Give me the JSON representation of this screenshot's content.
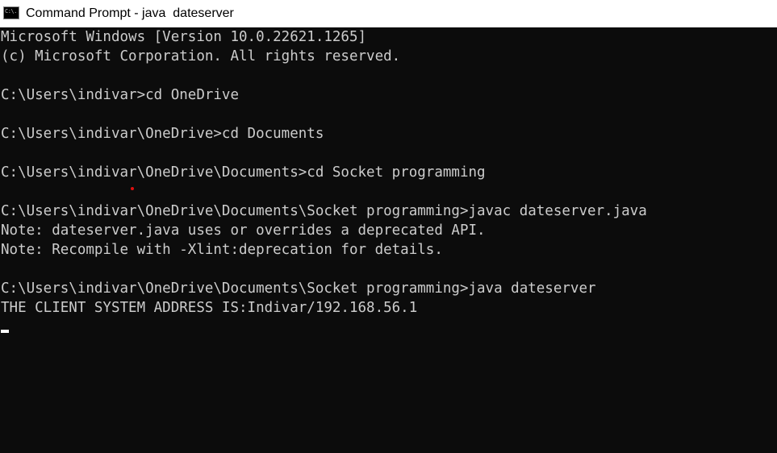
{
  "window": {
    "title": "Command Prompt - java  dateserver",
    "icon": "cmd-app-icon",
    "icon_text": "C:\\."
  },
  "colors": {
    "console_background": "#0c0c0c",
    "console_text": "#cccccc",
    "titlebar_background": "#ffffff",
    "cursor": "#ffffff",
    "marker_dot": "#e01010"
  },
  "console": {
    "lines": [
      "Microsoft Windows [Version 10.0.22621.1265]",
      "(c) Microsoft Corporation. All rights reserved.",
      "",
      "C:\\Users\\indivar>cd OneDrive",
      "",
      "C:\\Users\\indivar\\OneDrive>cd Documents",
      "",
      "C:\\Users\\indivar\\OneDrive\\Documents>cd Socket programming",
      "",
      "C:\\Users\\indivar\\OneDrive\\Documents\\Socket programming>javac dateserver.java",
      "Note: dateserver.java uses or overrides a deprecated API.",
      "Note: Recompile with -Xlint:deprecation for details.",
      "",
      "C:\\Users\\indivar\\OneDrive\\Documents\\Socket programming>java dateserver",
      "THE CLIENT SYSTEM ADDRESS IS:Indivar/192.168.56.1"
    ]
  }
}
